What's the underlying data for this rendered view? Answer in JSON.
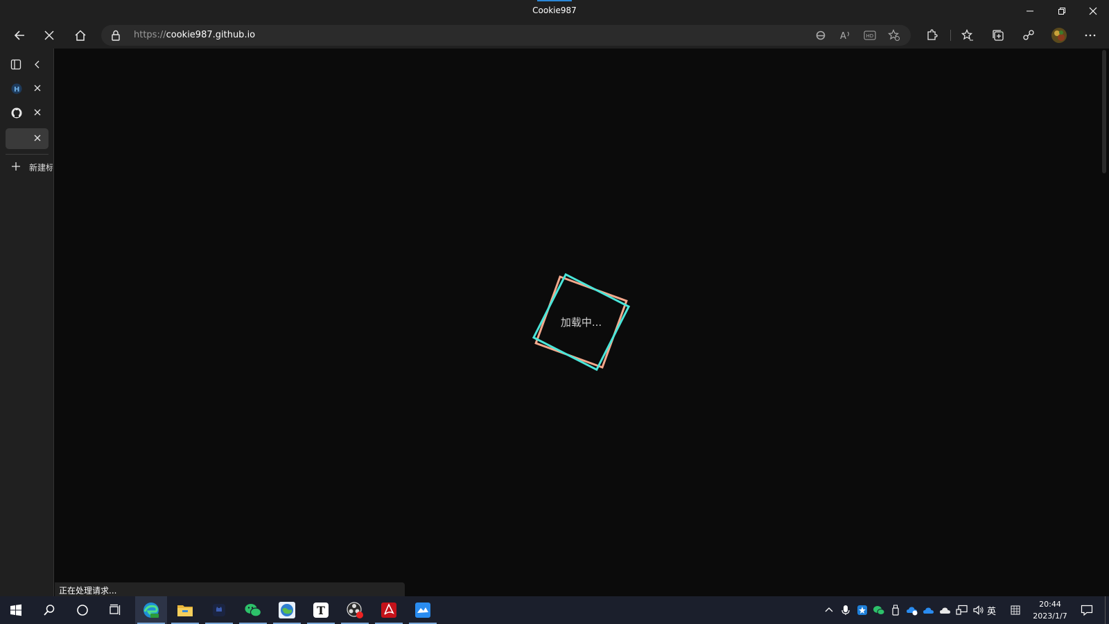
{
  "window": {
    "title": "Cookie987",
    "controls": [
      "minimize-icon",
      "restore-icon",
      "close-icon"
    ]
  },
  "toolbar": {
    "buttons": [
      "back-arrow-icon",
      "stop-loading-icon",
      "home-icon"
    ],
    "url_scheme": "https://",
    "url_host": "cookie987.github.io",
    "address_icons": [
      "internet-explorer-mode-icon",
      "read-aloud-icon",
      "video-hd-icon",
      "add-favorite-icon"
    ],
    "right_buttons": [
      "extensions-icon",
      "favorites-icon",
      "collections-icon",
      "share-icon",
      "profile-avatar",
      "more-icon"
    ]
  },
  "sidebar": {
    "tabs": [
      {
        "icon": "h-site-favicon"
      },
      {
        "icon": "github-icon"
      },
      {
        "icon": "blank-tab"
      }
    ],
    "new_tab_label": "新建标签页"
  },
  "page": {
    "loading_text": "加载中...",
    "status_text": "正在处理请求..."
  },
  "taskbar": {
    "apps": [
      "start-icon",
      "search-icon",
      "cortana-icon",
      "task-view-icon",
      "edge-icon",
      "file-explorer-icon",
      "app-cat-icon",
      "wechat-icon",
      "browser-globe-icon",
      "typora-icon",
      "obs-icon",
      "acrobat-icon",
      "feishu-icon"
    ],
    "tray_icons": [
      "chevron-up-icon",
      "microphone-icon",
      "app-tray-icon",
      "wechat-tray-icon",
      "usb-icon",
      "onedrive-sync-icon",
      "onedrive-icon",
      "cloud-icon",
      "network-icon",
      "volume-icon"
    ],
    "ime_label": "英",
    "time": "20:44",
    "date": "2023/1/7"
  },
  "colors": {
    "square_front": "#4ae6da",
    "square_back": "#f4a88c",
    "background": "#0b0b0b",
    "chrome": "#202020",
    "taskbar": "#1b1f2c"
  }
}
